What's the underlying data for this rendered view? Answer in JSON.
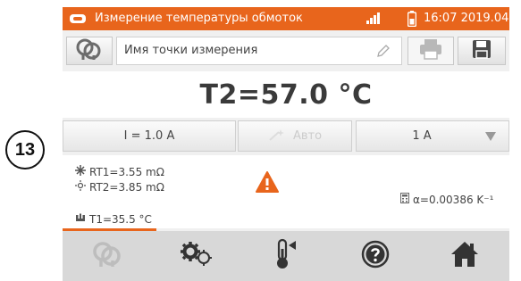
{
  "callout": {
    "number": "13"
  },
  "status_bar": {
    "title": "Измерение температуры обмоток",
    "time": "16:07 2019.04.10",
    "signal_icon": "signal-bars-icon",
    "battery_icon": "battery-icon"
  },
  "toolbar": {
    "point_placeholder": "Имя точки измерения",
    "left_icon": "probe-icon",
    "pencil_icon": "pencil-icon",
    "print_icon": "printer-icon",
    "save_icon": "save-icon"
  },
  "reading": {
    "text": "T2=57.0 °C"
  },
  "controls": {
    "current_value": "I = 1.0 A",
    "auto_label": "Авто",
    "range_value": "1 A"
  },
  "results": {
    "rt1": "RT1=3.55 mΩ",
    "rt2": "RT2=3.85 mΩ",
    "t1": "T1=35.5 °C",
    "alpha": "α=0.00386 K⁻¹",
    "warning_icon": "warning-icon"
  },
  "progress": {
    "fraction": 0.21
  },
  "bottom_nav": [
    {
      "icon": "probe-icon",
      "enabled": false
    },
    {
      "icon": "gears-icon",
      "enabled": true
    },
    {
      "icon": "thermometer-icon",
      "enabled": true
    },
    {
      "icon": "help-icon",
      "enabled": true
    },
    {
      "icon": "home-icon",
      "enabled": true
    }
  ],
  "colors": {
    "accent": "#e8651c",
    "text": "#3a3a3a",
    "nav_bg": "#d8d8d8"
  }
}
